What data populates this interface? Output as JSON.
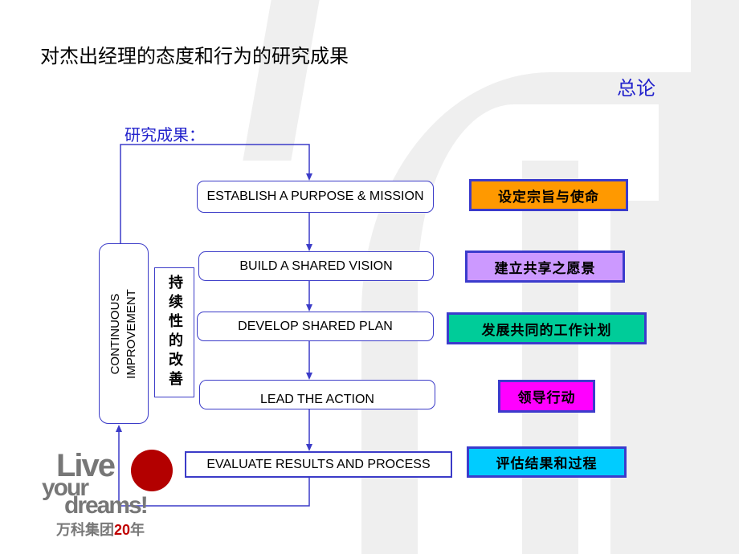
{
  "title": "对杰出经理的态度和行为的研究成果",
  "section": "总论",
  "subtitle": "研究成果：",
  "flow_steps": [
    "ESTABLISH A PURPOSE & MISSION",
    "BUILD A SHARED VISION",
    "DEVELOP SHARED PLAN",
    "LEAD THE ACTION",
    "EVALUATE RESULTS AND PROCESS"
  ],
  "loop_label": "CONTINUOUS IMPROVEMENT",
  "loop_label_cn": "持续性的改善",
  "tags": [
    {
      "label": "设定宗旨与使命",
      "color": "#ff9900"
    },
    {
      "label": "建立共享之愿景",
      "color": "#cc99ff"
    },
    {
      "label": "发展共同的工作计划",
      "color": "#00cc99"
    },
    {
      "label": "领导行动",
      "color": "#ff00ff"
    },
    {
      "label": "评估结果和过程",
      "color": "#00ccff"
    }
  ],
  "logo": {
    "line1": "Live",
    "line2": "your",
    "line3": "dreams!",
    "line4": "万科集团",
    "years": "20",
    "suffix": "年"
  },
  "colors": {
    "accent": "#3333cc",
    "title_blue": "#2222cc"
  }
}
